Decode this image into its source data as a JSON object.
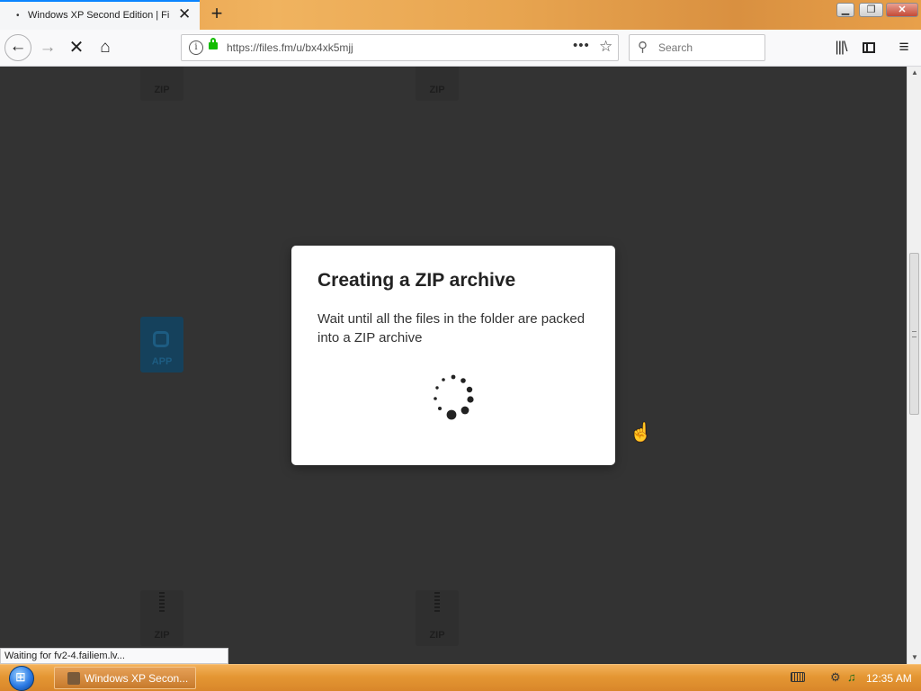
{
  "browser": {
    "tab_title": "Windows XP Second Edition | Fi",
    "url": "https://files.fm/u/bx4xk5mjj",
    "search_placeholder": "Search"
  },
  "files": {
    "zip_label": "ZIP",
    "app_label": "APP"
  },
  "modal": {
    "title": "Creating a ZIP archive",
    "message": "Wait until all the files in the folder are packed into a ZIP archive"
  },
  "status_text": "Waiting for fv2-4.failiem.lv...",
  "taskbar": {
    "task_label": "Windows XP Secon...",
    "clock": "12:35 AM"
  }
}
